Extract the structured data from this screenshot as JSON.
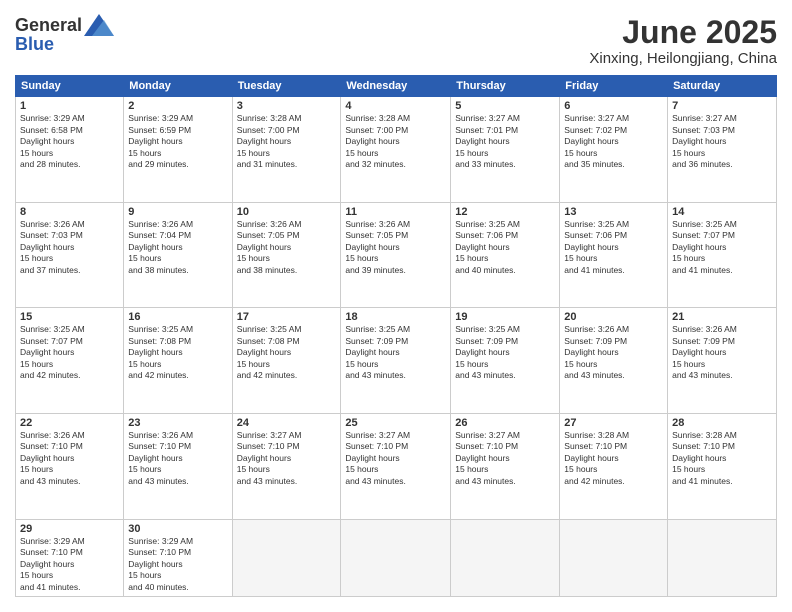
{
  "logo": {
    "line1": "General",
    "line2": "Blue"
  },
  "title": "June 2025",
  "location": "Xinxing, Heilongjiang, China",
  "headers": [
    "Sunday",
    "Monday",
    "Tuesday",
    "Wednesday",
    "Thursday",
    "Friday",
    "Saturday"
  ],
  "days": [
    {
      "num": "",
      "empty": true
    },
    {
      "num": "",
      "empty": true
    },
    {
      "num": "",
      "empty": true
    },
    {
      "num": "",
      "empty": true
    },
    {
      "num": "",
      "empty": true
    },
    {
      "num": "",
      "empty": true
    },
    {
      "num": "7",
      "sunrise": "3:27 AM",
      "sunset": "7:03 PM",
      "daylight": "15 hours and 36 minutes."
    },
    {
      "num": "8",
      "sunrise": "3:26 AM",
      "sunset": "7:03 PM",
      "daylight": "15 hours and 37 minutes."
    },
    {
      "num": "9",
      "sunrise": "3:26 AM",
      "sunset": "7:04 PM",
      "daylight": "15 hours and 38 minutes."
    },
    {
      "num": "10",
      "sunrise": "3:26 AM",
      "sunset": "7:05 PM",
      "daylight": "15 hours and 38 minutes."
    },
    {
      "num": "11",
      "sunrise": "3:26 AM",
      "sunset": "7:05 PM",
      "daylight": "15 hours and 39 minutes."
    },
    {
      "num": "12",
      "sunrise": "3:25 AM",
      "sunset": "7:06 PM",
      "daylight": "15 hours and 40 minutes."
    },
    {
      "num": "13",
      "sunrise": "3:25 AM",
      "sunset": "7:06 PM",
      "daylight": "15 hours and 41 minutes."
    },
    {
      "num": "14",
      "sunrise": "3:25 AM",
      "sunset": "7:07 PM",
      "daylight": "15 hours and 41 minutes."
    },
    {
      "num": "15",
      "sunrise": "3:25 AM",
      "sunset": "7:07 PM",
      "daylight": "15 hours and 42 minutes."
    },
    {
      "num": "16",
      "sunrise": "3:25 AM",
      "sunset": "7:08 PM",
      "daylight": "15 hours and 42 minutes."
    },
    {
      "num": "17",
      "sunrise": "3:25 AM",
      "sunset": "7:08 PM",
      "daylight": "15 hours and 42 minutes."
    },
    {
      "num": "18",
      "sunrise": "3:25 AM",
      "sunset": "7:09 PM",
      "daylight": "15 hours and 43 minutes."
    },
    {
      "num": "19",
      "sunrise": "3:25 AM",
      "sunset": "7:09 PM",
      "daylight": "15 hours and 43 minutes."
    },
    {
      "num": "20",
      "sunrise": "3:26 AM",
      "sunset": "7:09 PM",
      "daylight": "15 hours and 43 minutes."
    },
    {
      "num": "21",
      "sunrise": "3:26 AM",
      "sunset": "7:09 PM",
      "daylight": "15 hours and 43 minutes."
    },
    {
      "num": "22",
      "sunrise": "3:26 AM",
      "sunset": "7:10 PM",
      "daylight": "15 hours and 43 minutes."
    },
    {
      "num": "23",
      "sunrise": "3:26 AM",
      "sunset": "7:10 PM",
      "daylight": "15 hours and 43 minutes."
    },
    {
      "num": "24",
      "sunrise": "3:27 AM",
      "sunset": "7:10 PM",
      "daylight": "15 hours and 43 minutes."
    },
    {
      "num": "25",
      "sunrise": "3:27 AM",
      "sunset": "7:10 PM",
      "daylight": "15 hours and 43 minutes."
    },
    {
      "num": "26",
      "sunrise": "3:27 AM",
      "sunset": "7:10 PM",
      "daylight": "15 hours and 43 minutes."
    },
    {
      "num": "27",
      "sunrise": "3:28 AM",
      "sunset": "7:10 PM",
      "daylight": "15 hours and 42 minutes."
    },
    {
      "num": "28",
      "sunrise": "3:28 AM",
      "sunset": "7:10 PM",
      "daylight": "15 hours and 41 minutes."
    },
    {
      "num": "29",
      "sunrise": "3:29 AM",
      "sunset": "7:10 PM",
      "daylight": "15 hours and 41 minutes."
    },
    {
      "num": "30",
      "sunrise": "3:29 AM",
      "sunset": "7:10 PM",
      "daylight": "15 hours and 40 minutes."
    },
    {
      "num": "",
      "empty": true
    },
    {
      "num": "",
      "empty": true
    },
    {
      "num": "",
      "empty": true
    },
    {
      "num": "",
      "empty": true
    },
    {
      "num": "",
      "empty": true
    }
  ],
  "row1": [
    {
      "num": "1",
      "sunrise": "3:29 AM",
      "sunset": "6:58 PM",
      "daylight": "15 hours and 28 minutes."
    },
    {
      "num": "2",
      "sunrise": "3:29 AM",
      "sunset": "6:59 PM",
      "daylight": "15 hours and 29 minutes."
    },
    {
      "num": "3",
      "sunrise": "3:28 AM",
      "sunset": "7:00 PM",
      "daylight": "15 hours and 31 minutes."
    },
    {
      "num": "4",
      "sunrise": "3:28 AM",
      "sunset": "7:00 PM",
      "daylight": "15 hours and 32 minutes."
    },
    {
      "num": "5",
      "sunrise": "3:27 AM",
      "sunset": "7:01 PM",
      "daylight": "15 hours and 33 minutes."
    },
    {
      "num": "6",
      "sunrise": "3:27 AM",
      "sunset": "7:02 PM",
      "daylight": "15 hours and 35 minutes."
    },
    {
      "num": "7",
      "sunrise": "3:27 AM",
      "sunset": "7:03 PM",
      "daylight": "15 hours and 36 minutes."
    }
  ]
}
